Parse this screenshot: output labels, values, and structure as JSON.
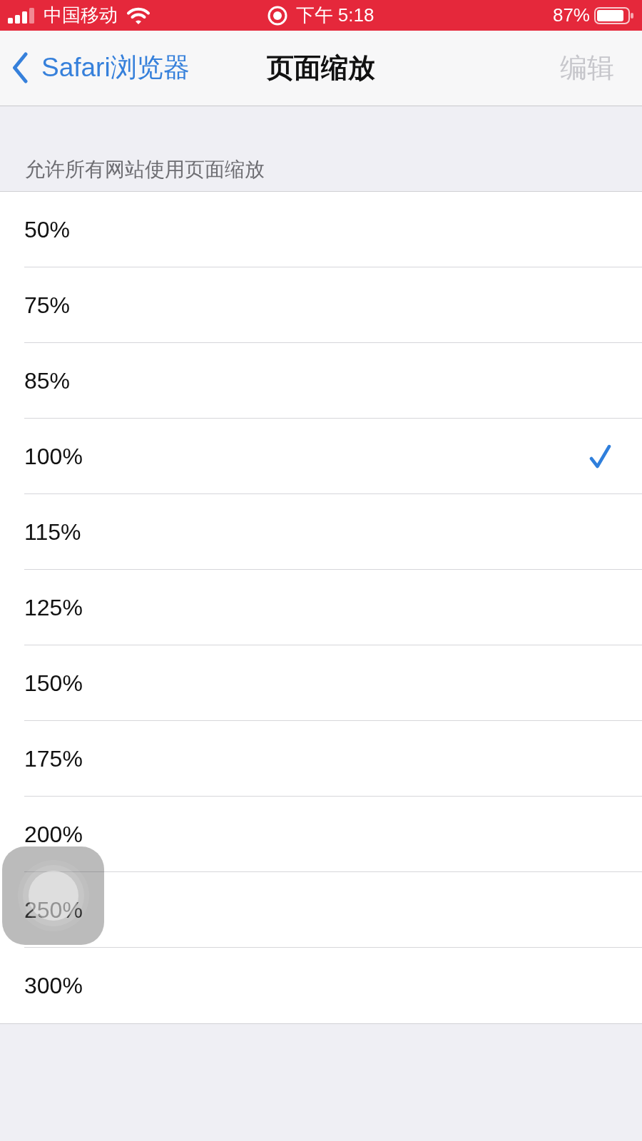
{
  "status_bar": {
    "carrier": "中国移动",
    "time": "下午 5:18",
    "battery": "87%"
  },
  "nav_bar": {
    "back": "Safari浏览器",
    "title": "页面缩放",
    "edit": {
      "label": "编辑",
      "disabled": true
    }
  },
  "zoom_section": {
    "header": "允许所有网站使用页面缩放",
    "options": [
      {
        "label": "50%",
        "selected": false
      },
      {
        "label": "75%",
        "selected": false
      },
      {
        "label": "85%",
        "selected": false
      },
      {
        "label": "100%",
        "selected": true
      },
      {
        "label": "115%",
        "selected": false
      },
      {
        "label": "125%",
        "selected": false
      },
      {
        "label": "150%",
        "selected": false
      },
      {
        "label": "175%",
        "selected": false
      },
      {
        "label": "200%",
        "selected": false
      },
      {
        "label": "250%",
        "selected": false
      },
      {
        "label": "300%",
        "selected": false
      }
    ]
  }
}
